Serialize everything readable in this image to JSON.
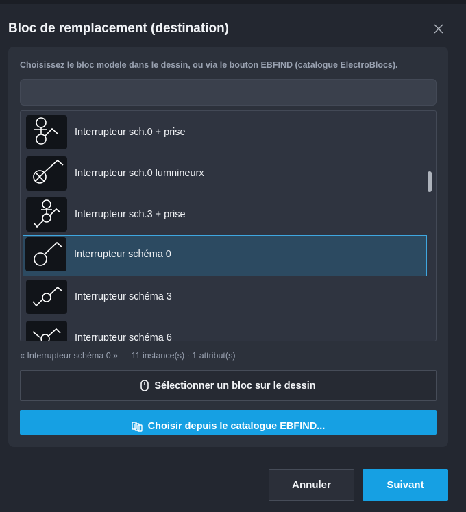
{
  "dialog": {
    "title": "Bloc de remplacement (destination)",
    "close_icon": "close-icon"
  },
  "panel": {
    "hint": "Choisissez le bloc modele dans le dessin, ou via le bouton EBFIND (catalogue ElectroBlocs).",
    "search": {
      "value": "",
      "placeholder": ""
    },
    "items": [
      {
        "label": "Interrupteur sch.0 + prise",
        "icon": "switch-socket-icon",
        "selected": false
      },
      {
        "label": "Interrupteur sch.0 lumnineurx",
        "icon": "switch-lamp-icon",
        "selected": false
      },
      {
        "label": "Interrupteur sch.3 + prise",
        "icon": "switch3-socket-icon",
        "selected": false
      },
      {
        "label": "Interrupteur schéma 0",
        "icon": "switch-0-icon",
        "selected": true
      },
      {
        "label": "Interrupteur schéma 3",
        "icon": "switch-3-icon",
        "selected": false
      },
      {
        "label": "Interrupteur schéma 6",
        "icon": "switch-6-icon",
        "selected": false
      }
    ],
    "status": "« Interrupteur schéma 0 » — 11 instance(s) · 1 attribut(s)",
    "select_button": {
      "label": "Sélectionner un bloc sur le dessin",
      "icon": "mouse-icon"
    },
    "catalog_button": {
      "label": "Choisir depuis le catalogue EBFIND...",
      "icon": "catalog-icon"
    }
  },
  "footer": {
    "cancel_label": "Annuler",
    "next_label": "Suivant"
  },
  "colors": {
    "background": "#232730",
    "panel": "#2c313b",
    "accent": "#16a0e3",
    "selected_row": "#2c4a61",
    "selected_border": "#3fa7e0"
  }
}
